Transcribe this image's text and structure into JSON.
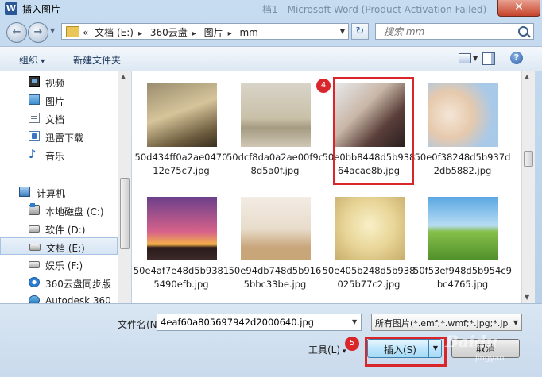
{
  "window": {
    "title": "插入图片",
    "background_title": "档1 - Microsoft Word (Product Activation Failed)",
    "close_label": "✕"
  },
  "nav": {
    "path": [
      "«",
      "文档 (E:)",
      "360云盘",
      "图片",
      "mm"
    ],
    "search_placeholder": "搜索 mm"
  },
  "toolbar": {
    "organize_label": "组织",
    "new_folder_label": "新建文件夹"
  },
  "sidebar": {
    "items": [
      {
        "label": "视频",
        "icon": "video-icon"
      },
      {
        "label": "图片",
        "icon": "picture-icon"
      },
      {
        "label": "文档",
        "icon": "document-icon"
      },
      {
        "label": "迅雷下载",
        "icon": "thunder-download-icon"
      },
      {
        "label": "音乐",
        "icon": "music-icon"
      },
      {
        "label": "计算机",
        "icon": "computer-icon"
      },
      {
        "label": "本地磁盘 (C:)",
        "icon": "system-drive-icon"
      },
      {
        "label": "软件 (D:)",
        "icon": "drive-icon"
      },
      {
        "label": "文档 (E:)",
        "icon": "drive-icon"
      },
      {
        "label": "娱乐 (F:)",
        "icon": "drive-icon"
      },
      {
        "label": "360云盘同步版",
        "icon": "cloud-sync-icon"
      },
      {
        "label": "Autodesk 360",
        "icon": "autodesk-icon"
      }
    ]
  },
  "files": [
    {
      "name": "50d434ff0a2ae047012e75c7.jpg"
    },
    {
      "name": "50dcf8da0a2ae00f9c8d5a0f.jpg"
    },
    {
      "name": "50e0bb8448d5b93864acae8b.jpg"
    },
    {
      "name": "50e0f38248d5b937d2db5882.jpg"
    },
    {
      "name": "50e4af7e48d5b93815490efb.jpg"
    },
    {
      "name": "50e94db748d5b9165bbc33be.jpg"
    },
    {
      "name": "50e405b248d5b938025b77c2.jpg"
    },
    {
      "name": "50f53ef948d5b954c9bc4765.jpg"
    }
  ],
  "bottom": {
    "filename_label": "文件名(N):",
    "filename_value": "4eaf60a805697942d2000640.jpg",
    "filter_value": "所有图片(*.emf;*.wmf;*.jpg;*.jp",
    "tools_label": "工具(L)",
    "insert_label": "插入(S)",
    "cancel_label": "取消"
  },
  "annotations": {
    "step4": "4",
    "step5": "5"
  },
  "watermark": {
    "text": "Baidu",
    "sub": "jingyan"
  },
  "colors": {
    "annotation_red": "#d8262a",
    "accent_blue": "#3c7fb1"
  }
}
